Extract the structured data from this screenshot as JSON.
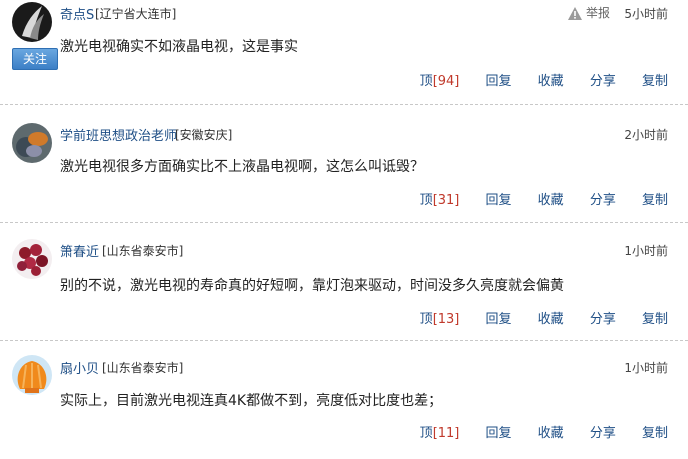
{
  "comments": [
    {
      "name": "奇点S",
      "location": "[辽宁省大连市]",
      "time": "5小时前",
      "text": "激光电视确实不如液晶电视，这是事实",
      "top_label": "顶",
      "top_count": "[94]",
      "reply": "回复",
      "collect": "收藏",
      "share": "分享",
      "copy": "复制",
      "follow": "关注",
      "report": "举报"
    },
    {
      "name": "学前班思想政治老师",
      "location": "[安徽安庆]",
      "time": "2小时前",
      "text": "激光电视很多方面确实比不上液晶电视啊，这怎么叫诋毁？",
      "top_label": "顶",
      "top_count": "[31]",
      "reply": "回复",
      "collect": "收藏",
      "share": "分享",
      "copy": "复制"
    },
    {
      "name": "箫春近",
      "location": "[山东省泰安市]",
      "time": "1小时前",
      "text": "别的不说，激光电视的寿命真的好短啊，靠灯泡来驱动，时间没多久亮度就会偏黄",
      "top_label": "顶",
      "top_count": "[13]",
      "reply": "回复",
      "collect": "收藏",
      "share": "分享",
      "copy": "复制"
    },
    {
      "name": "扇小贝",
      "location": "[山东省泰安市]",
      "time": "1小时前",
      "text": "实际上，目前激光电视连真4K都做不到，亮度低对比度也差；",
      "top_label": "顶",
      "top_count": "[11]",
      "reply": "回复",
      "collect": "收藏",
      "share": "分享",
      "copy": "复制"
    }
  ]
}
